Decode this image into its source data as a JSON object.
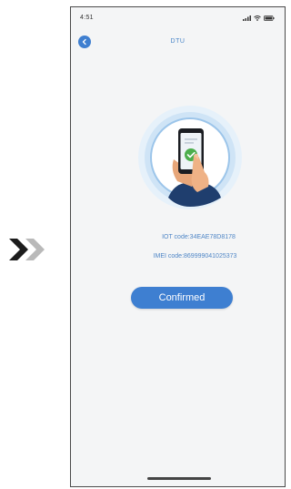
{
  "status_bar": {
    "time": "4:51",
    "icons": [
      "signal-icon",
      "wifi-icon",
      "battery-icon"
    ]
  },
  "header": {
    "title": "DTU",
    "back_icon": "back-icon"
  },
  "hero": {
    "icon": "phone-confirmed-illustration"
  },
  "device": {
    "iot_code": "IOT code:34EAE78D8178",
    "imei_code": "IMEI code:869999041025373"
  },
  "actions": {
    "confirm_label": "Confirmed"
  },
  "colors": {
    "accent": "#3e7fd1",
    "text_blue": "#4f86c6",
    "screen_bg": "#f4f5f6"
  }
}
